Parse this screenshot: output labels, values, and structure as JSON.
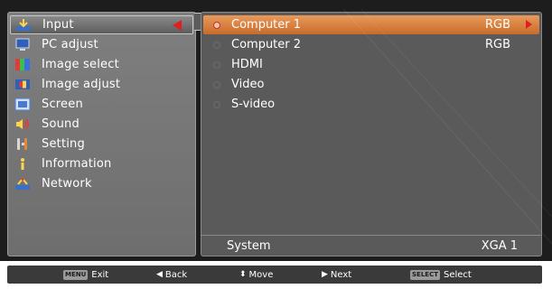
{
  "menu": {
    "items": [
      {
        "label": "Input",
        "icon": "input-icon",
        "active": true
      },
      {
        "label": "PC adjust",
        "icon": "pc-adjust-icon"
      },
      {
        "label": "Image select",
        "icon": "image-select-icon"
      },
      {
        "label": "Image adjust",
        "icon": "image-adjust-icon"
      },
      {
        "label": "Screen",
        "icon": "screen-icon"
      },
      {
        "label": "Sound",
        "icon": "sound-icon"
      },
      {
        "label": "Setting",
        "icon": "setting-icon"
      },
      {
        "label": "Information",
        "icon": "information-icon"
      },
      {
        "label": "Network",
        "icon": "network-icon"
      }
    ]
  },
  "inputs": [
    {
      "label": "Computer 1",
      "value": "RGB",
      "selected": true
    },
    {
      "label": "Computer 2",
      "value": "RGB"
    },
    {
      "label": "HDMI",
      "value": ""
    },
    {
      "label": "Video",
      "value": ""
    },
    {
      "label": "S-video",
      "value": ""
    }
  ],
  "system": {
    "label": "System",
    "value": "XGA 1"
  },
  "footer": {
    "exit": {
      "key": "MENU",
      "label": "Exit"
    },
    "back": {
      "label": "Back"
    },
    "move": {
      "label": "Move"
    },
    "next": {
      "label": "Next"
    },
    "select": {
      "key": "SELECT",
      "label": "Select"
    }
  },
  "colors": {
    "accent": "#e02020",
    "selected_row": "#d97c3c",
    "panel": "#5a5a5a",
    "menu_panel": "#777777"
  }
}
